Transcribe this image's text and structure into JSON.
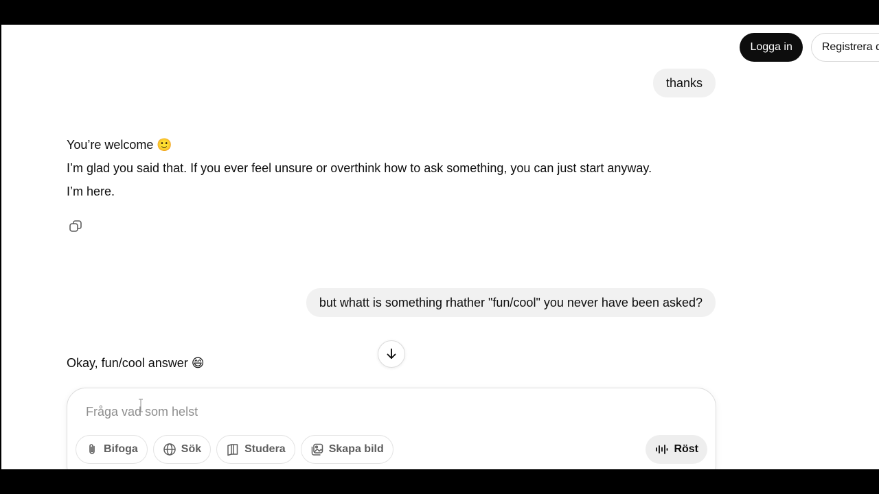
{
  "header": {
    "login_label": "Logga in",
    "register_label": "Registrera d"
  },
  "conversation": {
    "user_message_1": "thanks",
    "assistant_message_1": {
      "line_1": "You’re welcome 🙂",
      "line_2": "I’m glad you said that. If you ever feel unsure or overthink how to ask something, you can just start anyway.",
      "line_3": "I’m here."
    },
    "user_message_2": "but whatt is something rhather \"fun/cool\" you never have been asked?",
    "assistant_message_2": {
      "line_1": "Okay, fun/cool answer 😄"
    }
  },
  "composer": {
    "placeholder": "Fråga vad som helst",
    "tools": [
      {
        "label": "Bifoga",
        "icon": "paperclip-icon"
      },
      {
        "label": "Sök",
        "icon": "globe-icon"
      },
      {
        "label": "Studera",
        "icon": "book-icon"
      },
      {
        "label": "Skapa bild",
        "icon": "image-icon"
      }
    ],
    "voice_label": "Röst"
  },
  "colors": {
    "primary_dark": "#0d0d0d",
    "user_bubble": "#f1f1f1",
    "border": "#dcdcdc",
    "muted_text": "#5d5d5d",
    "placeholder_text": "#8e8e8e"
  }
}
